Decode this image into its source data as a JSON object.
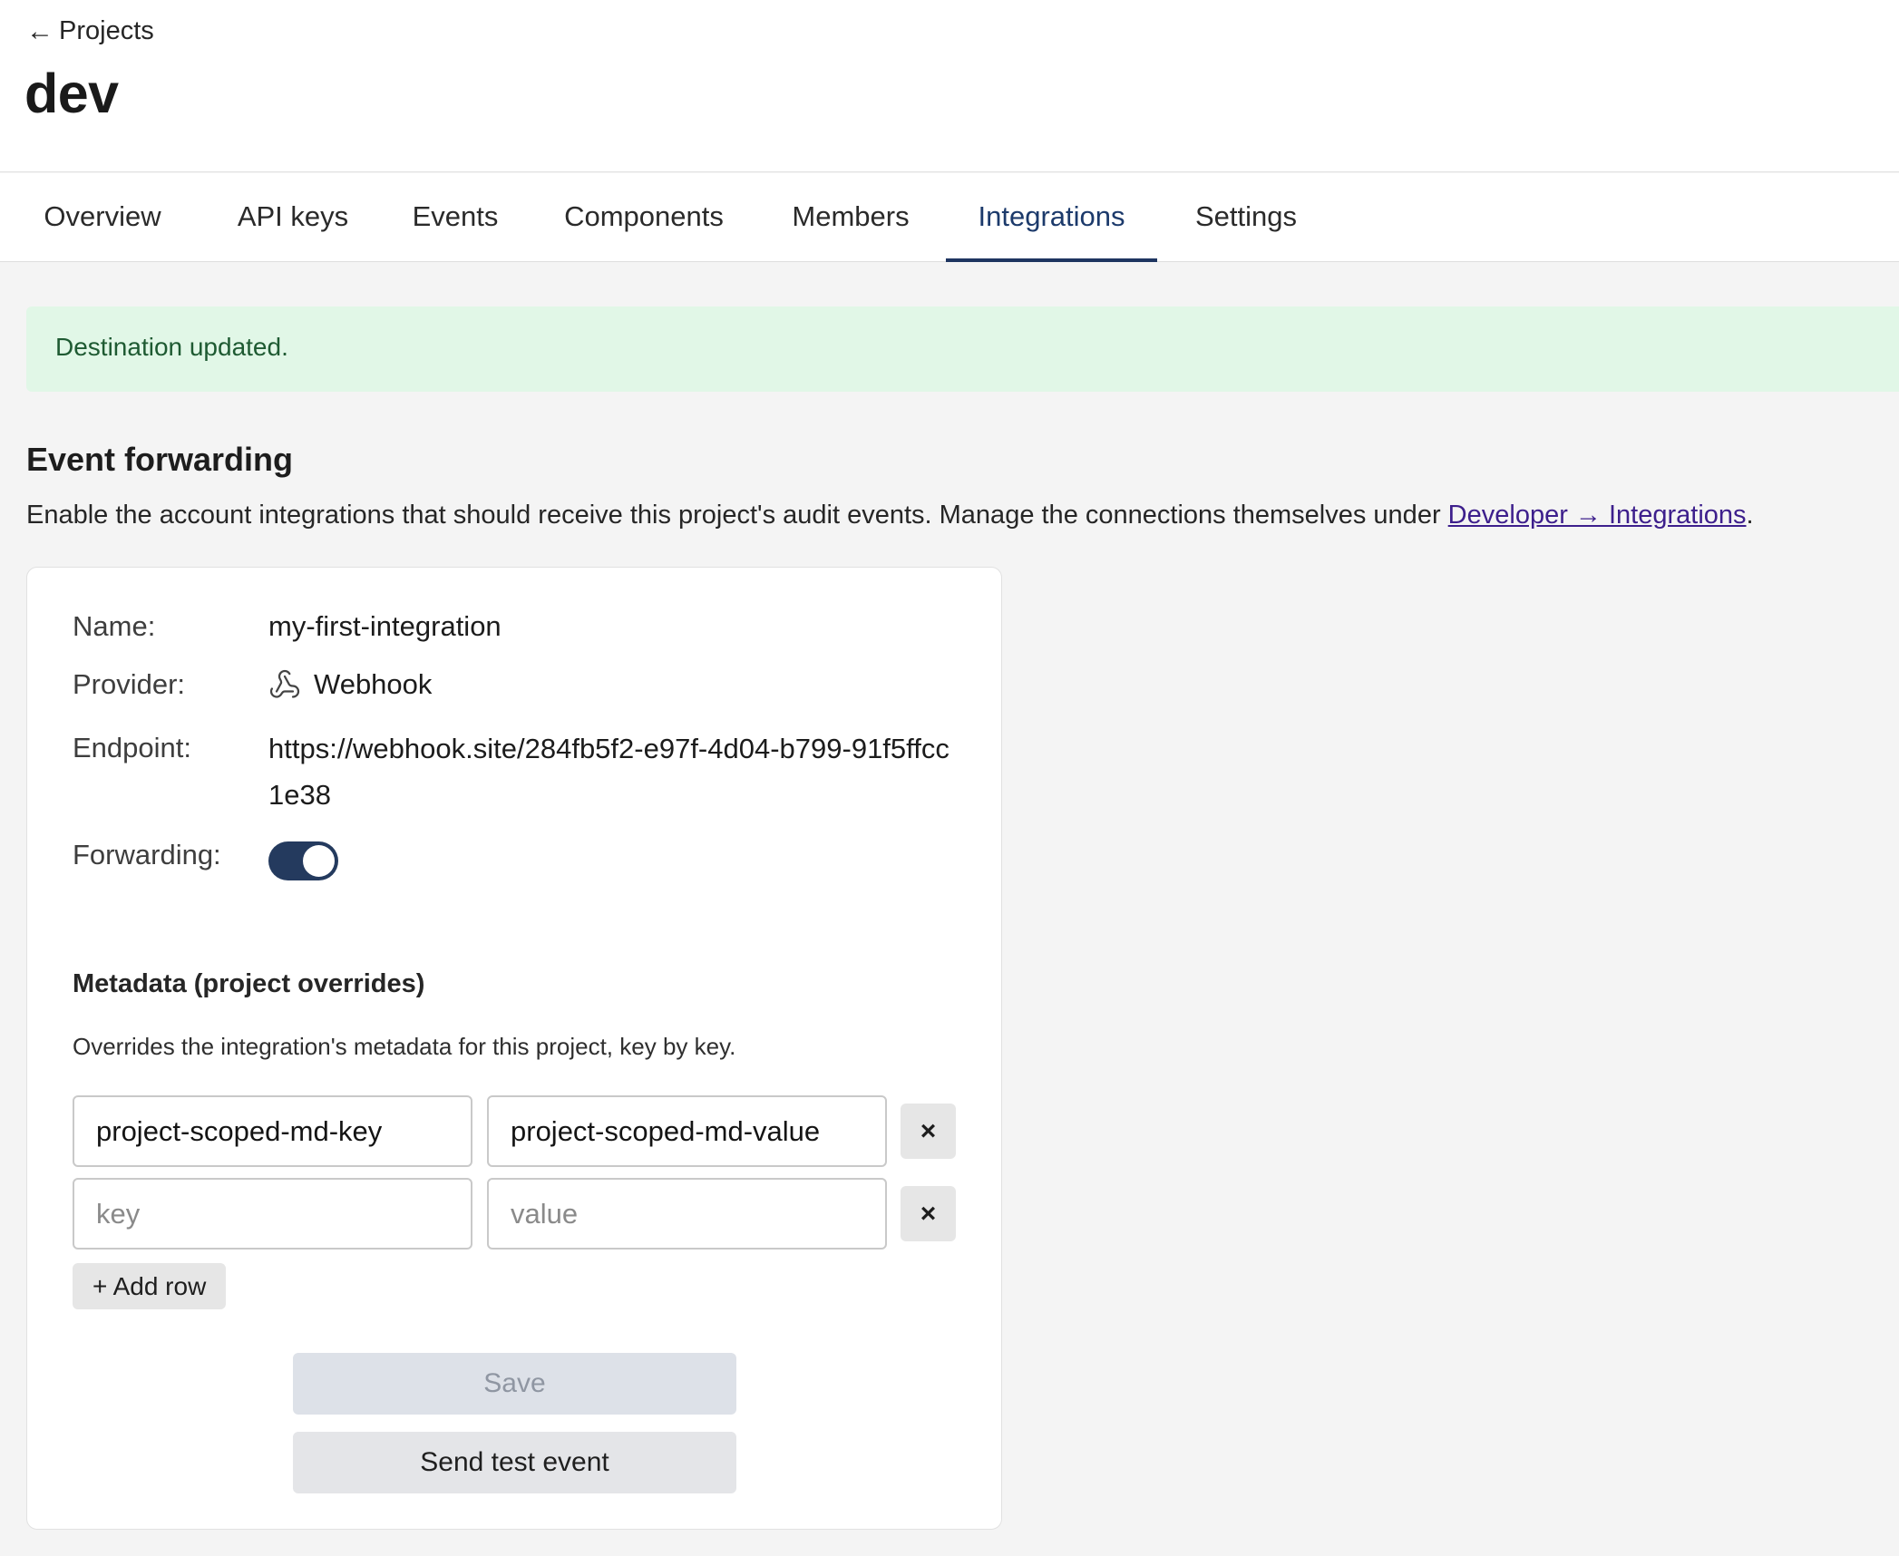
{
  "header": {
    "back_label": "Projects",
    "title": "dev"
  },
  "tabs": [
    {
      "label": "Overview",
      "active": false
    },
    {
      "label": "API keys",
      "active": false
    },
    {
      "label": "Events",
      "active": false
    },
    {
      "label": "Components",
      "active": false
    },
    {
      "label": "Members",
      "active": false
    },
    {
      "label": "Integrations",
      "active": true
    },
    {
      "label": "Settings",
      "active": false
    }
  ],
  "alert": {
    "message": "Destination updated."
  },
  "event_forwarding": {
    "title": "Event forwarding",
    "description_prefix": "Enable the account integrations that should receive this project's audit events. Manage the connections themselves under ",
    "description_link": "Developer → Integrations",
    "description_suffix": "."
  },
  "integration": {
    "name_label": "Name:",
    "name_value": "my-first-integration",
    "provider_label": "Provider:",
    "provider_icon": "webhook-icon",
    "provider_value": "Webhook",
    "endpoint_label": "Endpoint:",
    "endpoint_value": "https://webhook.site/284fb5f2-e97f-4d04-b799-91f5ffcc1e38",
    "forwarding_label": "Forwarding:",
    "forwarding_enabled": true
  },
  "metadata": {
    "title": "Metadata (project overrides)",
    "description": "Overrides the integration's metadata for this project, key by key.",
    "rows": [
      {
        "key": "project-scoped-md-key",
        "value": "project-scoped-md-value"
      },
      {
        "key": "",
        "value": ""
      }
    ],
    "key_placeholder": "key",
    "value_placeholder": "value",
    "remove_symbol": "×",
    "add_row_label": "+ Add row"
  },
  "actions": {
    "save_label": "Save",
    "test_label": "Send test event"
  },
  "colors": {
    "accent": "#1e3560",
    "alert_bg": "#e1f7e7",
    "alert_text": "#1e5a32",
    "link": "#3d1f8c"
  }
}
